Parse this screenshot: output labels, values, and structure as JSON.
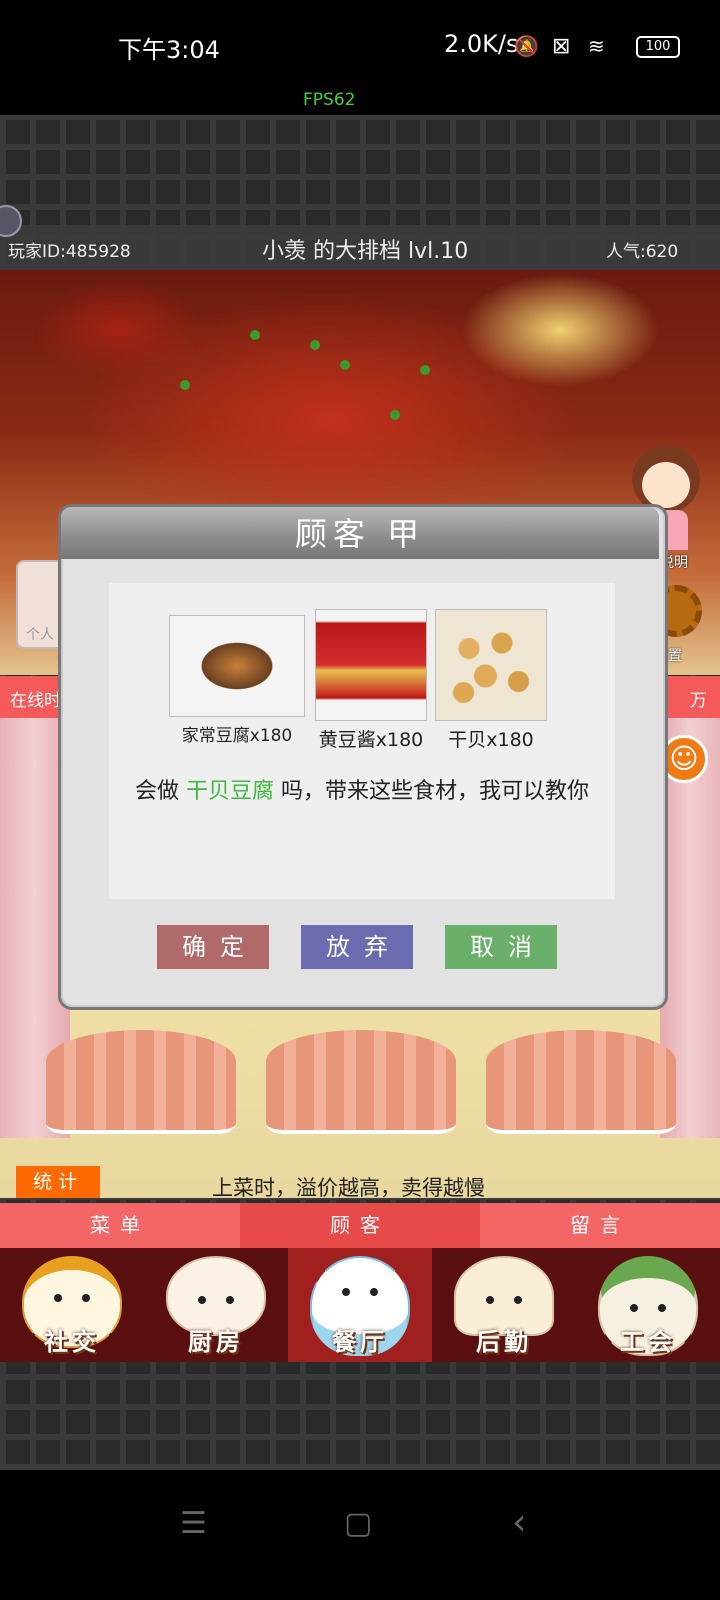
{
  "status_bar": {
    "time": "下午3:04",
    "speed": "2.0K/s",
    "battery": "100",
    "fps": "FPS62"
  },
  "header": {
    "player_id": "玩家ID:485928",
    "shop_title": "小羡 的大排档 lvl.10",
    "popularity": "人气:620"
  },
  "side": {
    "left_label": "个人",
    "right_char_label": "说明",
    "gear_label": "置",
    "online_label": "在线时",
    "online_right": "万"
  },
  "dialog": {
    "title": "顾客 甲",
    "ingredients": [
      {
        "label": "家常豆腐x180"
      },
      {
        "label": "黄豆酱x180"
      },
      {
        "label": "干贝x180"
      }
    ],
    "message_prefix": "会做 ",
    "message_dish": "干贝豆腐",
    "message_suffix": " 吗，带来这些食材，我可以教你",
    "buttons": {
      "confirm": "确定",
      "abandon": "放弃",
      "cancel": "取消"
    },
    "colors": {
      "confirm": "#b06a6a",
      "abandon": "#6b6bb0",
      "cancel": "#6ab06a",
      "highlight": "#3cba3c"
    }
  },
  "stage": {
    "stats_button": "统计",
    "tip": "上菜时，溢价越高，卖得越慢"
  },
  "tabs": [
    "菜单",
    "顾客",
    "留言"
  ],
  "bottom_nav": [
    {
      "label": "社交",
      "icon": "ramen-bowl-icon"
    },
    {
      "label": "厨房",
      "icon": "bun-icon"
    },
    {
      "label": "餐厅",
      "icon": "rice-bowl-icon"
    },
    {
      "label": "后勤",
      "icon": "dumpling-icon"
    },
    {
      "label": "工会",
      "icon": "zongzi-icon"
    }
  ],
  "system_nav": {
    "menu": "☰",
    "home": "▢",
    "back": "‹"
  }
}
